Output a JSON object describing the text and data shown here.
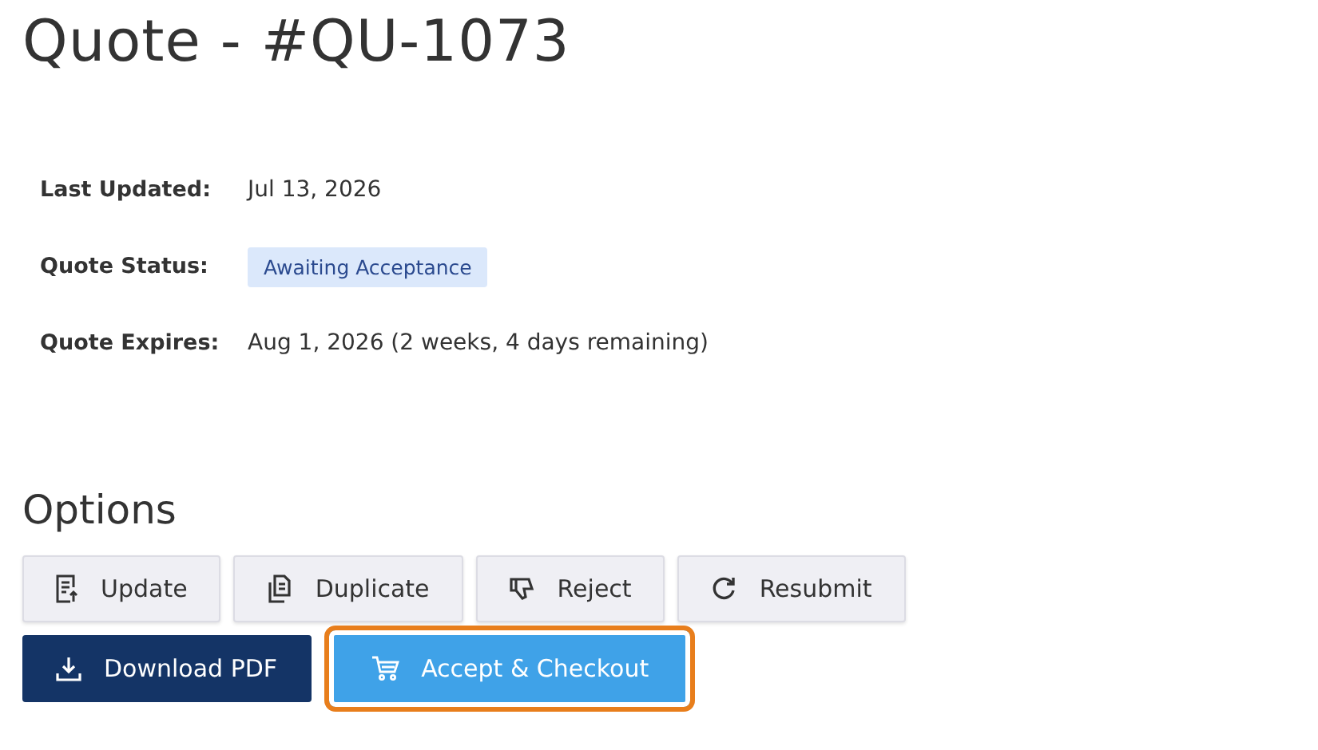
{
  "title": "Quote - #QU-1073",
  "details": [
    {
      "label": "Last Updated:",
      "value": "Jul 13, 2026",
      "kind": "text"
    },
    {
      "label": "Quote Status:",
      "value": "Awaiting Acceptance",
      "kind": "badge"
    },
    {
      "label": "Quote Expires:",
      "value": "Aug 1, 2026 (2 weeks, 4 days remaining)",
      "kind": "text"
    }
  ],
  "options_heading": "Options",
  "button_rows": [
    [
      {
        "label": "Update",
        "kind": "secondary",
        "focused": false
      },
      {
        "label": "Duplicate",
        "kind": "secondary",
        "focused": false
      },
      {
        "label": "Reject",
        "kind": "secondary",
        "focused": false
      },
      {
        "label": "Resubmit",
        "kind": "secondary",
        "focused": false
      }
    ],
    [
      {
        "label": "Download PDF",
        "kind": "dark",
        "focused": false
      },
      {
        "label": "Accept & Checkout",
        "kind": "light",
        "focused": true
      }
    ]
  ]
}
